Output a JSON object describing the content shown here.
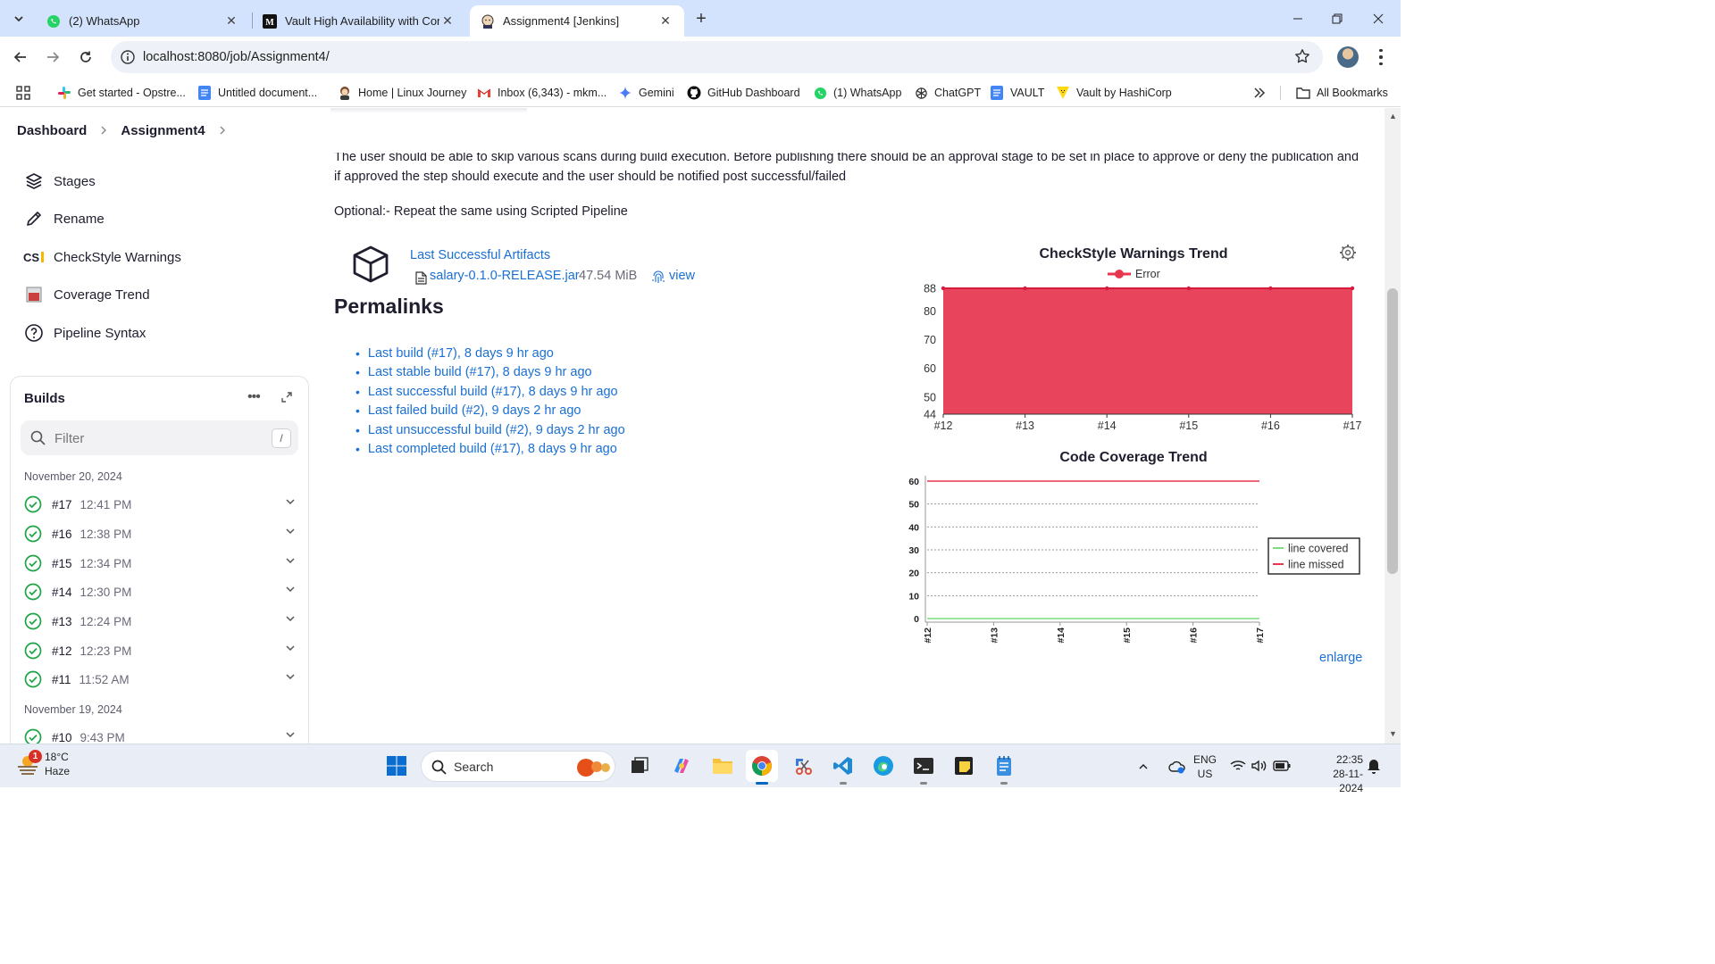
{
  "browser": {
    "tabs": [
      {
        "title": "(2) WhatsApp",
        "icon": "whatsapp-icon",
        "active": false
      },
      {
        "title": "Vault High Availability with Con",
        "icon": "medium-icon",
        "active": false
      },
      {
        "title": "Assignment4 [Jenkins]",
        "icon": "jenkins-icon",
        "active": true
      }
    ],
    "url": "localhost:8080/job/Assignment4/",
    "bookmarks": [
      {
        "label": "Get started - Opstre...",
        "icon": "slack-icon"
      },
      {
        "label": "Untitled document...",
        "icon": "docs-icon"
      },
      {
        "label": "Home | Linux Journey",
        "icon": "linux-journey-icon"
      },
      {
        "label": "Inbox (6,343) - mkm...",
        "icon": "gmail-icon"
      },
      {
        "label": "Gemini",
        "icon": "gemini-icon"
      },
      {
        "label": "GitHub Dashboard",
        "icon": "github-icon"
      },
      {
        "label": "(1) WhatsApp",
        "icon": "whatsapp-icon"
      },
      {
        "label": "ChatGPT",
        "icon": "chatgpt-icon"
      },
      {
        "label": "VAULT",
        "icon": "docs-icon"
      },
      {
        "label": "Vault by HashiCorp",
        "icon": "hashicorp-icon"
      }
    ],
    "all_bookmarks": "All Bookmarks"
  },
  "breadcrumbs": {
    "dashboard": "Dashboard",
    "job": "Assignment4"
  },
  "sidebar": {
    "items": [
      {
        "label": "Stages",
        "icon": "stages-icon"
      },
      {
        "label": "Rename",
        "icon": "pencil-icon"
      },
      {
        "label": "CheckStyle Warnings",
        "icon": "checkstyle-icon"
      },
      {
        "label": "Coverage Trend",
        "icon": "coverage-icon"
      },
      {
        "label": "Pipeline Syntax",
        "icon": "help-icon"
      }
    ]
  },
  "builds": {
    "title": "Builds",
    "filter_placeholder": "Filter",
    "filter_shortcut": "/",
    "groups": [
      {
        "date": "November 20, 2024",
        "items": [
          {
            "number": "#17",
            "time": "12:41 PM"
          },
          {
            "number": "#16",
            "time": "12:38 PM"
          },
          {
            "number": "#15",
            "time": "12:34 PM"
          },
          {
            "number": "#14",
            "time": "12:30 PM"
          },
          {
            "number": "#13",
            "time": "12:24 PM"
          },
          {
            "number": "#12",
            "time": "12:23 PM"
          },
          {
            "number": "#11",
            "time": "11:52 AM"
          }
        ]
      },
      {
        "date": "November 19, 2024",
        "items": [
          {
            "number": "#10",
            "time": "9:43 PM"
          }
        ]
      }
    ]
  },
  "description": {
    "text": "The user should be able to skip various scans during build execution. Before publishing there should be an approval stage to be set in place to approve or deny the publication and if approved the step should execute and the user should be notified post successful/failed",
    "optional": "Optional:- Repeat the same using Scripted Pipeline"
  },
  "artifacts": {
    "title": "Last Successful Artifacts",
    "file": "salary-0.1.0-RELEASE.jar",
    "size": "47.54 MiB",
    "view": "view"
  },
  "permalinks": {
    "title": "Permalinks",
    "items": [
      "Last build (#17), 8 days 9 hr ago",
      "Last stable build (#17), 8 days 9 hr ago",
      "Last successful build (#17), 8 days 9 hr ago",
      "Last failed build (#2), 9 days 2 hr ago",
      "Last unsuccessful build (#2), 9 days 2 hr ago",
      "Last completed build (#17), 8 days 9 hr ago"
    ]
  },
  "chart_data": [
    {
      "type": "area",
      "title": "CheckStyle Warnings Trend",
      "legend_position": "top",
      "x": [
        "#12",
        "#13",
        "#14",
        "#15",
        "#16",
        "#17"
      ],
      "series": [
        {
          "name": "Error",
          "values": [
            88,
            88,
            88,
            88,
            88,
            88
          ],
          "color": "#e8364f"
        }
      ],
      "yticks": [
        44,
        50,
        60,
        70,
        80,
        88
      ],
      "ylim": [
        44,
        88
      ]
    },
    {
      "type": "line",
      "title": "Code Coverage Trend",
      "legend_position": "right",
      "x": [
        "#12",
        "#13",
        "#14",
        "#15",
        "#16",
        "#17"
      ],
      "series": [
        {
          "name": "line covered",
          "values": [
            0,
            0,
            0,
            0,
            0,
            0
          ],
          "color": "#7ddc7d"
        },
        {
          "name": "line missed",
          "values": [
            60,
            60,
            60,
            60,
            60,
            60
          ],
          "color": "#e8364f"
        }
      ],
      "yticks": [
        0,
        10,
        20,
        30,
        40,
        50,
        60
      ],
      "ylim": [
        0,
        60
      ],
      "grid": true
    }
  ],
  "enlarge": "enlarge",
  "taskbar": {
    "weather": {
      "temp": "18°C",
      "condition": "Haze",
      "badge": "1"
    },
    "search": "Search",
    "lang": {
      "line1": "ENG",
      "line2": "US"
    },
    "clock": {
      "time": "22:35",
      "date": "28-11-2024"
    }
  }
}
